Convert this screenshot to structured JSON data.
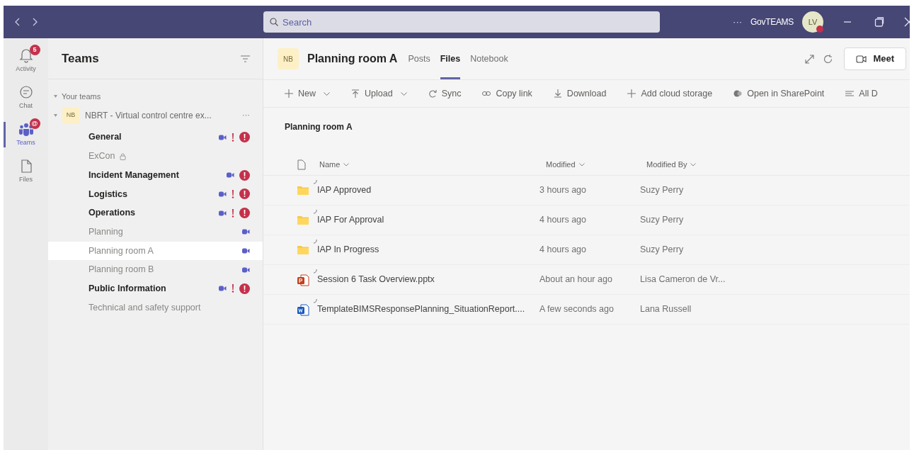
{
  "title_bar": {
    "search": {
      "placeholder": "Search"
    },
    "more": "···",
    "org": "GovTEAMS",
    "avatar": {
      "initials": "LV"
    }
  },
  "rail": [
    {
      "label": "Activity",
      "kind": "bell",
      "badge": "5",
      "selected": false
    },
    {
      "label": "Chat",
      "kind": "chat",
      "selected": false
    },
    {
      "label": "Teams",
      "kind": "teams",
      "badge": "@",
      "selected": true
    },
    {
      "label": "Files",
      "kind": "file",
      "selected": false
    }
  ],
  "teams_panel": {
    "title": "Teams",
    "section": "Your teams",
    "team": {
      "initials": "NB",
      "name": "NBRT - Virtual control centre ex...",
      "more": "···",
      "expanded": true,
      "channels": [
        {
          "name": "General",
          "unread": true,
          "selected": false,
          "meeting": true,
          "important": true,
          "alert": true
        },
        {
          "name": "ExCon",
          "unread": false,
          "selected": false,
          "private": true
        },
        {
          "name": "Incident Management",
          "unread": true,
          "selected": false,
          "meeting": true,
          "alert": true
        },
        {
          "name": "Logistics",
          "unread": true,
          "selected": false,
          "meeting": true,
          "important": true,
          "alert": true
        },
        {
          "name": "Operations",
          "unread": true,
          "selected": false,
          "meeting": true,
          "important": true,
          "alert": true
        },
        {
          "name": "Planning",
          "unread": false,
          "selected": false,
          "meeting": true
        },
        {
          "name": "Planning room A",
          "unread": false,
          "selected": true,
          "meeting": true
        },
        {
          "name": "Planning room B",
          "unread": false,
          "selected": false,
          "meeting": true
        },
        {
          "name": "Public Information",
          "unread": true,
          "selected": false,
          "meeting": true,
          "important": true,
          "alert": true
        },
        {
          "name": "Technical and safety support",
          "unread": false,
          "selected": false
        }
      ]
    }
  },
  "channel_header": {
    "initials": "NB",
    "title": "Planning room A",
    "tabs": [
      {
        "label": "Posts",
        "selected": false
      },
      {
        "label": "Files",
        "selected": true
      },
      {
        "label": "Notebook",
        "selected": false
      }
    ],
    "meet": "Meet"
  },
  "toolbar": [
    {
      "label": "New",
      "kind": "plus",
      "dropdown": true
    },
    {
      "label": "Upload",
      "kind": "upload",
      "dropdown": true
    },
    {
      "label": "Sync",
      "kind": "sync",
      "dropdown": false
    },
    {
      "label": "Copy link",
      "kind": "link",
      "dropdown": false
    },
    {
      "label": "Download",
      "kind": "download",
      "dropdown": false
    },
    {
      "label": "Add cloud storage",
      "kind": "plus",
      "dropdown": false
    },
    {
      "label": "Open in SharePoint",
      "kind": "sharepoint",
      "dropdown": false
    },
    {
      "label": "All D",
      "kind": "lines",
      "dropdown": false
    }
  ],
  "files": {
    "breadcrumb": "Planning room A",
    "columns": [
      "Name",
      "Modified",
      "Modified By"
    ],
    "rows": [
      {
        "kind": "folder",
        "name": "IAP Approved",
        "modified": "3 hours ago",
        "modified_by": "Suzy Perry"
      },
      {
        "kind": "folder",
        "name": "IAP For Approval",
        "modified": "4 hours ago",
        "modified_by": "Suzy Perry"
      },
      {
        "kind": "folder",
        "name": "IAP In Progress",
        "modified": "4 hours ago",
        "modified_by": "Suzy Perry"
      },
      {
        "kind": "pptx",
        "name": "Session 6 Task Overview.pptx",
        "modified": "About an hour ago",
        "modified_by": "Lisa Cameron de Vr..."
      },
      {
        "kind": "docx",
        "name": "TemplateBIMSResponsePlanning_SituationReport....",
        "modified": "A few seconds ago",
        "modified_by": "Lana Russell"
      }
    ]
  }
}
